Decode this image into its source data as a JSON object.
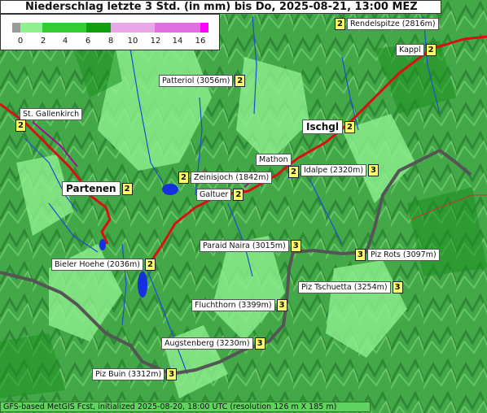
{
  "title": "Niederschlag letzte 3 Std. (in mm) bis Do, 2025-08-21, 13:00 MEZ",
  "legend": {
    "ticks": [
      "0",
      "2",
      "4",
      "6",
      "8",
      "10",
      "12",
      "14",
      "16"
    ],
    "colors": [
      "#9a9a9a",
      "#8ff08f",
      "#33cc33",
      "#0f9f0f",
      "#e8a8e8",
      "#e070e0",
      "#ff00ff"
    ]
  },
  "footer": "GFS-based MetGIS Fcst, initialized 2025-08-20, 18:00 UTC  (resolution 126 m X 185 m)",
  "places": [
    {
      "id": "rendelspitze",
      "name": "Rendelspitze (2816m)",
      "value": "2"
    },
    {
      "id": "kappl",
      "name": "Kappl",
      "value": "2"
    },
    {
      "id": "patteriol",
      "name": "Patteriol (3056m)",
      "value": "2"
    },
    {
      "id": "st-gallenkirch",
      "name": "St. Gallenkirch",
      "value": "2"
    },
    {
      "id": "ischgl",
      "name": "Ischgl",
      "value": "2"
    },
    {
      "id": "mathon",
      "name": "Mathon",
      "value": "2"
    },
    {
      "id": "idalpe",
      "name": "Idalpe (2320m)",
      "value": "3"
    },
    {
      "id": "zeinisjoch",
      "name": "Zeinisjoch (1842m)",
      "value": "2"
    },
    {
      "id": "partenen",
      "name": "Partenen",
      "value": "2"
    },
    {
      "id": "galtuer",
      "name": "Galtuer",
      "value": "2"
    },
    {
      "id": "paraid-naira",
      "name": "Paraid Naira (3015m)",
      "value": "3"
    },
    {
      "id": "piz-rots",
      "name": "Piz Rots (3097m)",
      "value": "3"
    },
    {
      "id": "bieler-hoehe",
      "name": "Bieler Hoehe (2036m)",
      "value": "2"
    },
    {
      "id": "piz-tschuetta",
      "name": "Piz Tschuetta (3254m)",
      "value": "3"
    },
    {
      "id": "fluchthorn",
      "name": "Fluchthorn (3399m)",
      "value": "3"
    },
    {
      "id": "augstenberg",
      "name": "Augstenberg (3230m)",
      "value": "3"
    },
    {
      "id": "piz-buin",
      "name": "Piz Buin (3312m)",
      "value": "3"
    }
  ]
}
